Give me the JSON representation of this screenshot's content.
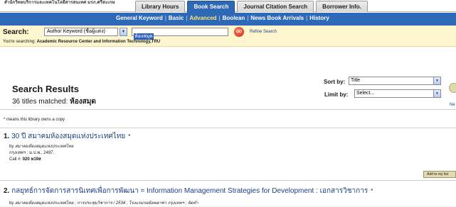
{
  "header": {
    "library_name": "สำนักวิทยบริการและเทคโนโลยีสารสนเทศ มรภ.ศรีสะเกษ",
    "tabs": [
      {
        "label": "Library Hours",
        "active": false
      },
      {
        "label": "Book Search",
        "active": true
      },
      {
        "label": "Journal Citation Search",
        "active": false
      },
      {
        "label": "Borrower Info.",
        "active": false
      }
    ]
  },
  "nav": {
    "links": [
      "General Keyword",
      "Basic",
      "Advanced",
      "Boolean",
      "News Book Arrivals",
      "History"
    ],
    "current": "Advanced"
  },
  "search": {
    "label": "Search:",
    "type_value": "Author Keyword (ชื่อผู้แต่ง)",
    "query_value": "ห้องสมุด",
    "go_label": "GO",
    "refine_label": "Refine Search",
    "searching_prefix": "You're searching:",
    "searching_target": "Academic Resource Center and Information Technology,TRU"
  },
  "results": {
    "title": "Search Results",
    "matched_prefix": "36 titles matched:",
    "matched_term": "ห้องสมุด",
    "sort_label": "Sort by:",
    "sort_value": "Title",
    "limit_label": "Limit by:",
    "limit_value": "Select...",
    "side_text": "Ne",
    "owns_copy_note": "* means this library owns a copy"
  },
  "records": [
    {
      "number": "1.",
      "title": "30 ปี สมาคมห้องสมุดแห่งประเทศไทย",
      "star": "*",
      "by_prefix": "by",
      "author": "สมาคมห้องสมุดแห่งประเทศไทย",
      "publication": "กรุงเทพฯ : ม.ป.พ., 2497.",
      "call_prefix": "Call #:",
      "call_number": "020 ห19ส",
      "add_button": "Add to my list"
    },
    {
      "number": "2.",
      "title": "กลยุทธ์การจัดการสารนิเทศเพื่อการพัฒนา = Information Management Strategies for Development : เอกสารวิชาการ",
      "star": "*",
      "by_prefix": "by",
      "author": "สมาคมห้องสมุดแห่งประเทศไทย ; การประชุมวิชาการ / 2534 ; โรงแรมรอยัลพลาซ่า กรุงเทพฯ ; จัดทำ"
    }
  ],
  "colors": {
    "nav_blue": "#2d69b6",
    "search_bg": "#fdf6cf",
    "link_blue": "#1d3f86",
    "current_nav": "#ffe36a",
    "go_red": "#c42b10"
  },
  "icons": {
    "dropdown": "chevron-down-icon",
    "go": "go-button-icon"
  }
}
